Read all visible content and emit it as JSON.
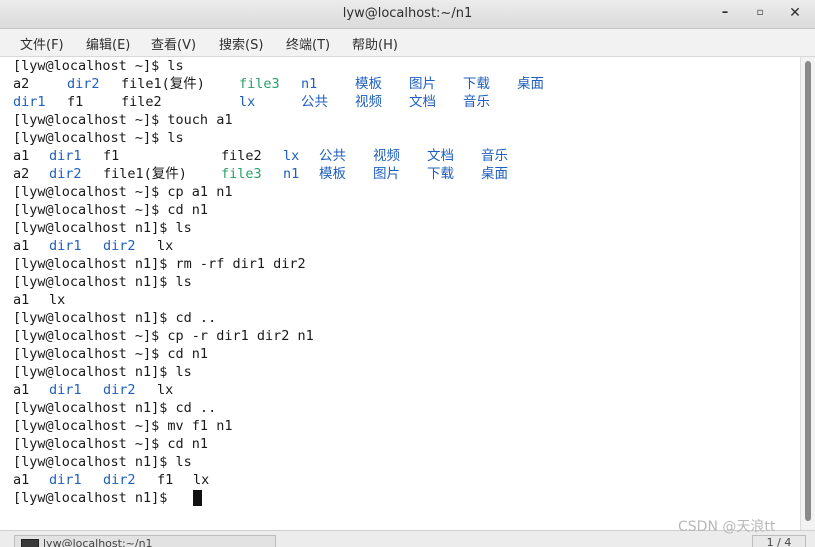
{
  "window": {
    "title": "lyw@localhost:~/n1",
    "minimize_glyph": "–",
    "maximize_glyph": "▫",
    "close_glyph": "✕"
  },
  "menu": {
    "items": [
      "文件(F)",
      "编辑(E)",
      "查看(V)",
      "搜索(S)",
      "终端(T)",
      "帮助(H)"
    ]
  },
  "terminal": {
    "lines": [
      "[lyw@localhost ~]$ ls",
      "a2  dir2  file1(复件)  file3  n1  模板  图片  下载  桌面",
      "dir1  f1  file2  lx  公共  视频  文档  音乐",
      "[lyw@localhost ~]$ touch a1",
      "[lyw@localhost ~]$ ls",
      "a1  dir1  f1  file2  lx  公共  视频  文档  音乐",
      "a2  dir2  file1(复件)  file3  n1  模板  图片  下载  桌面",
      "[lyw@localhost ~]$ cp a1 n1",
      "[lyw@localhost ~]$ cd n1",
      "[lyw@localhost n1]$ ls",
      "a1  dir1  dir2  lx",
      "[lyw@localhost n1]$ rm -rf dir1 dir2",
      "[lyw@localhost n1]$ ls",
      "a1  lx",
      "[lyw@localhost n1]$ cd ..",
      "[lyw@localhost ~]$ cp -r dir1 dir2 n1",
      "[lyw@localhost ~]$ cd n1",
      "[lyw@localhost n1]$ ls",
      "a1  dir1  dir2  lx",
      "[lyw@localhost n1]$ cd ..",
      "[lyw@localhost ~]$ mv f1 n1",
      "[lyw@localhost ~]$ cd n1",
      "[lyw@localhost n1]$ ls",
      "a1  dir1  dir2  f1  lx",
      "[lyw@localhost n1]$ "
    ],
    "colors": {
      "text": "#1a1a1a",
      "directory": "#1f5fbf",
      "executable": "#26a269"
    }
  },
  "taskbar": {
    "window_label": "lyw@localhost:~/n1",
    "pager": "1 / 4"
  },
  "watermark": "CSDN @天浪tt"
}
